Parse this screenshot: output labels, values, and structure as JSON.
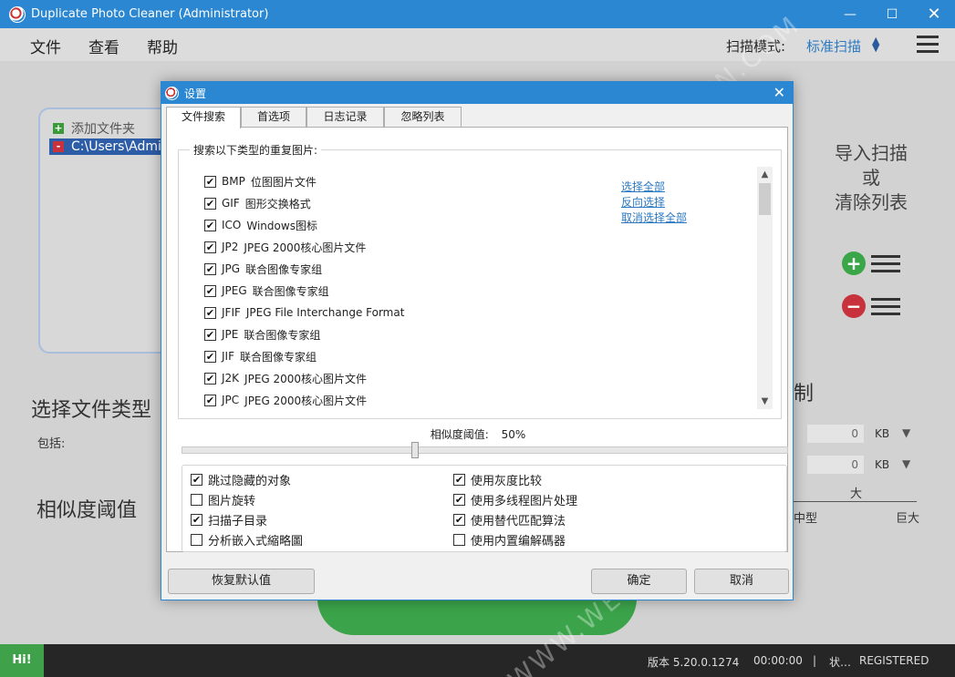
{
  "window": {
    "title": "Duplicate Photo Cleaner (Administrator)"
  },
  "menu": {
    "file": "文件",
    "view": "查看",
    "help": "帮助",
    "scan_mode_label": "扫描模式:",
    "scan_mode_value": "标准扫描"
  },
  "main": {
    "folders": [
      {
        "label": "添加文件夹",
        "kind": "add"
      },
      {
        "label": "C:\\Users\\Admin",
        "kind": "remove"
      }
    ],
    "import_lines": [
      "导入扫描",
      "或",
      "清除列表"
    ],
    "select_file_types": "选择文件类型",
    "include_label": "包括:",
    "similarity_title": "相似度阈值",
    "limit_title_fragment": "制",
    "min_size": "0",
    "max_size": "0",
    "unit": "KB",
    "large_label": "大",
    "medium_label": "中型",
    "huge_label": "巨大"
  },
  "status": {
    "hi": "Hi!",
    "version": "版本 5.20.0.1274",
    "time": "00:00:00",
    "separator": "|",
    "state": "状…",
    "registered": "REGISTERED"
  },
  "dialog": {
    "title": "设置",
    "tabs": [
      "文件搜索",
      "首选项",
      "日志记录",
      "忽略列表"
    ],
    "group_label": "搜索以下类型的重复图片:",
    "file_types": [
      {
        "ext": "BMP",
        "desc": "位图图片文件",
        "checked": true
      },
      {
        "ext": "GIF",
        "desc": "图形交换格式",
        "checked": true
      },
      {
        "ext": "ICO",
        "desc": "Windows图标",
        "checked": true
      },
      {
        "ext": "JP2",
        "desc": "JPEG 2000核心图片文件",
        "checked": true
      },
      {
        "ext": "JPG",
        "desc": "联合图像专家组",
        "checked": true
      },
      {
        "ext": "JPEG",
        "desc": "联合图像专家组",
        "checked": true
      },
      {
        "ext": "JFIF",
        "desc": "JPEG File Interchange Format",
        "checked": true
      },
      {
        "ext": "JPE",
        "desc": "联合图像专家组",
        "checked": true
      },
      {
        "ext": "JIF",
        "desc": "联合图像专家组",
        "checked": true
      },
      {
        "ext": "J2K",
        "desc": "JPEG 2000核心图片文件",
        "checked": true
      },
      {
        "ext": "JPC",
        "desc": "JPEG 2000核心图片文件",
        "checked": true
      }
    ],
    "links": {
      "select_all": "选择全部",
      "invert": "反向选择",
      "deselect_all": "取消选择全部"
    },
    "similarity_label": "相似度阈值:",
    "similarity_value": "50%",
    "similarity_level": 0.4,
    "options": [
      {
        "label": "跳过隐藏的对象",
        "checked": true
      },
      {
        "label": "图片旋转",
        "checked": false
      },
      {
        "label": "扫描子目录",
        "checked": true
      },
      {
        "label": "分析嵌入式縮略圖",
        "checked": false
      },
      {
        "label": "使用灰度比较",
        "checked": true
      },
      {
        "label": "使用多线程图片处理",
        "checked": true
      },
      {
        "label": "使用替代匹配算法",
        "checked": true
      },
      {
        "label": "使用内置编解碼器",
        "checked": false
      }
    ],
    "restore_defaults": "恢复默认值",
    "ok": "确定",
    "cancel": "取消"
  },
  "watermark": "WWW.WEIDOWN.COM",
  "colors": {
    "titlebar": "#2b87d1",
    "link": "#2b79c2",
    "green": "#3ba34a",
    "status_bg": "#262626"
  }
}
